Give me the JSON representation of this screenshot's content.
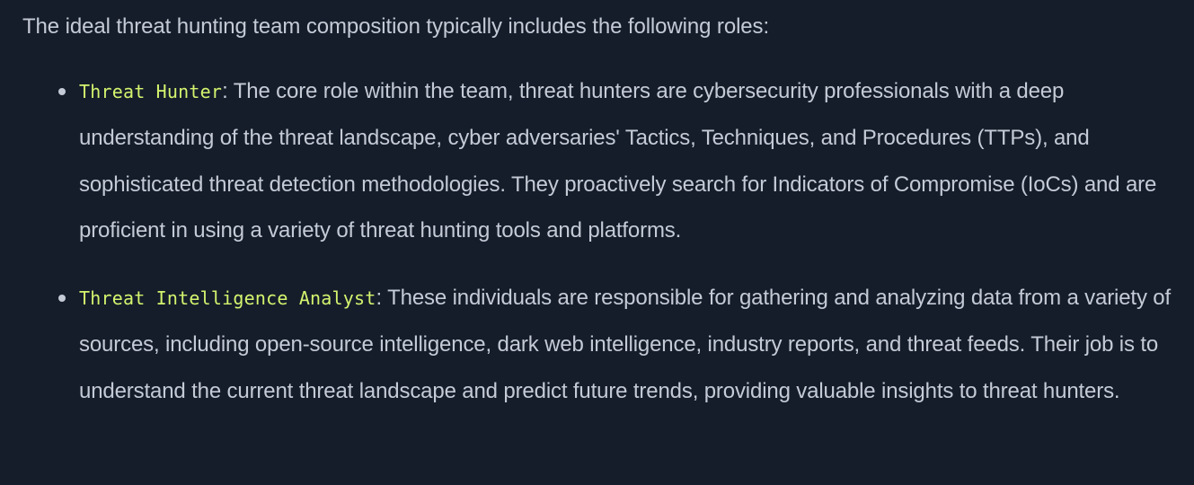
{
  "intro": "The ideal threat hunting team composition typically includes the following roles:",
  "roles": [
    {
      "term": "Threat Hunter",
      "description": ": The core role within the team, threat hunters are cybersecurity professionals with a deep understanding of the threat landscape, cyber adversaries' Tactics, Techniques, and Procedures (TTPs), and sophisticated threat detection methodologies. They proactively search for Indicators of Compromise (IoCs) and are proficient in using a variety of threat hunting tools and platforms."
    },
    {
      "term": "Threat Intelligence Analyst",
      "description": ": These individuals are responsible for gathering and analyzing data from a variety of sources, including open-source intelligence, dark web intelligence, industry reports, and threat feeds. Their job is to understand the current threat landscape and predict future trends, providing valuable insights to threat hunters."
    }
  ],
  "colors": {
    "background": "#151d2b",
    "text": "#c5cbd6",
    "accent": "#d4f46e"
  }
}
